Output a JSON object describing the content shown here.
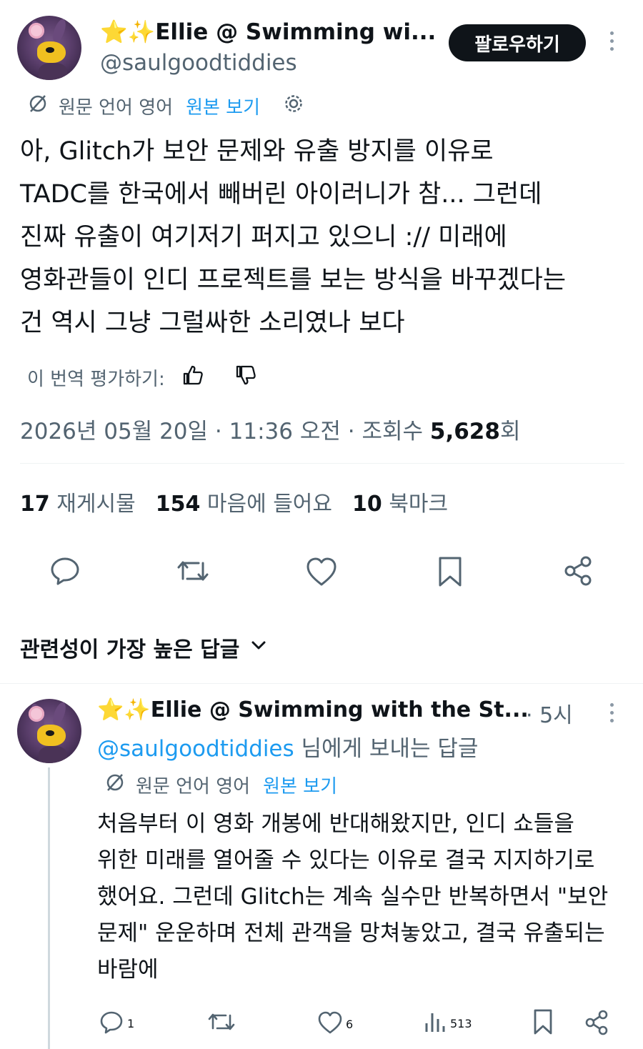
{
  "tweet": {
    "display_name": "⭐✨Ellie @ Swimming wi...",
    "handle": "@saulgoodtiddies",
    "follow_label": "팔로우하기",
    "translation": {
      "original_language": "원문 언어 영어",
      "view_original": "원본 보기"
    },
    "body_lines": [
      "아, Glitch가 보안 문제와 유출 방지를 이유로",
      "TADC를 한국에서 빼버린 아이러니가 참... 그런데",
      "진짜 유출이 여기저기 퍼지고 있으니 :// 미래에",
      "영화관들이 인디 프로젝트를 보는 방식을 바꾸겠다는",
      "건 역시 그냥 그럴싸한 소리였나 보다"
    ],
    "rate_label": "이 번역 평가하기:",
    "date": "2026년 05월 20일",
    "time": "11:36 오전",
    "views_label": "조회수",
    "views_count": "5,628",
    "views_suffix": "회",
    "stats": {
      "reposts_count": "17",
      "reposts_label": "재게시물",
      "likes_count": "154",
      "likes_label": "마음에 들어요",
      "bookmarks_count": "10",
      "bookmarks_label": "북마크"
    }
  },
  "sort": {
    "label": "관련성이 가장 높은 답글"
  },
  "reply": {
    "display_name": "⭐✨Ellie @ Swimming with the St...",
    "time": "· 5시",
    "reply_to_handle": "@saulgoodtiddies",
    "reply_to_suffix": " 님에게 보내는 답글",
    "translation": {
      "original_language": "원문 언어 영어",
      "view_original": "원본 보기"
    },
    "body_lines": [
      "처음부터 이 영화 개봉에 반대해왔지만, 인디 쇼들을",
      "위한 미래를 열어줄 수 있다는 이유로 결국 지지하기로",
      "했어요. 그런데 Glitch는 계속 실수만 반복하면서 \"보안",
      "문제\" 운운하며 전체 관객을 망쳐놓았고, 결국 유출되는",
      "바람에"
    ],
    "actions": {
      "replies": "1",
      "likes": "6",
      "views": "513"
    }
  },
  "colors": {
    "text": "#0f1419",
    "secondary": "#536471",
    "link": "#1d9bf0",
    "divider": "#eff3f4"
  }
}
